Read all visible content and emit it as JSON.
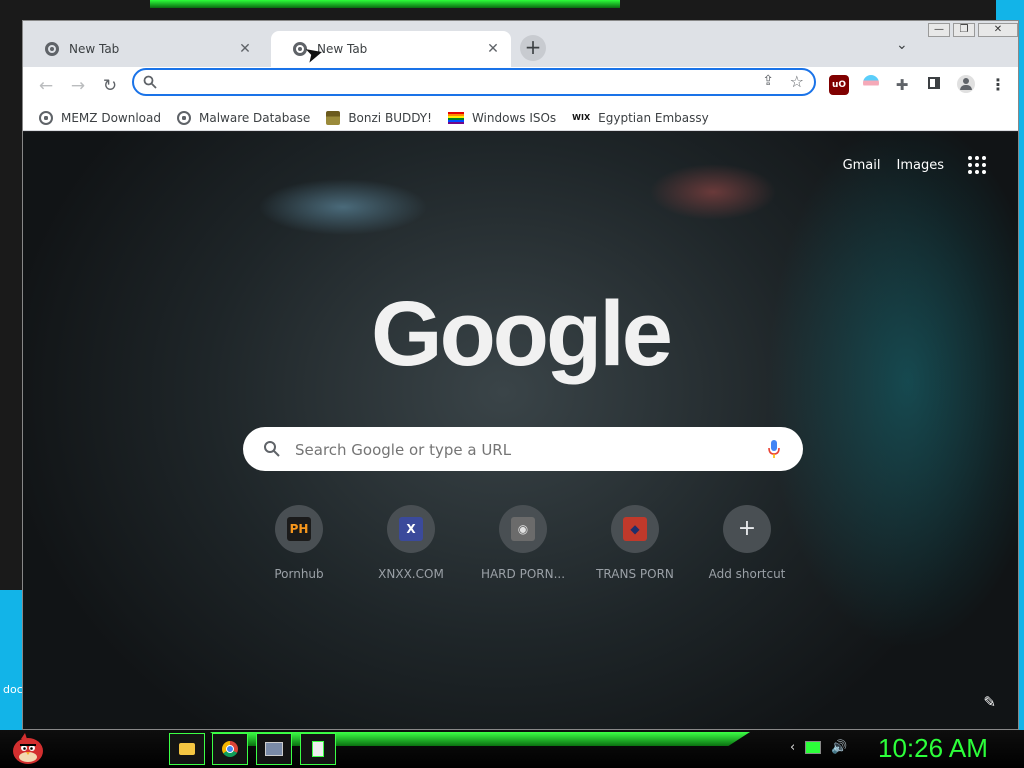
{
  "tabs": [
    {
      "label": "New Tab",
      "active": false
    },
    {
      "label": "New Tab",
      "active": true
    }
  ],
  "address_bar": {
    "value": "",
    "placeholder": ""
  },
  "bookmarks": [
    {
      "label": "MEMZ Download",
      "icon": "globe-icon"
    },
    {
      "label": "Malware Database",
      "icon": "globe-icon"
    },
    {
      "label": "Bonzi BUDDY!",
      "icon": "bonzi-icon"
    },
    {
      "label": "Windows ISOs",
      "icon": "rainbow-flag-icon"
    },
    {
      "label": "Egyptian Embassy",
      "icon": "wix-icon"
    }
  ],
  "page": {
    "top_links": {
      "gmail": "Gmail",
      "images": "Images"
    },
    "logo": "Google",
    "search_placeholder": "Search Google or type a URL",
    "shortcuts": [
      {
        "label": "Pornhub",
        "fav": "PH",
        "fav_bg": "#1b1b1b",
        "fav_color": "#f7971d"
      },
      {
        "label": "XNXX.COM",
        "fav": "X",
        "fav_bg": "#3b4a9b",
        "fav_color": "#ffffff"
      },
      {
        "label": "HARD PORN...",
        "fav": "◉",
        "fav_bg": "#6b6b6b",
        "fav_color": "#e0e0e0"
      },
      {
        "label": "TRANS PORN",
        "fav": "◆",
        "fav_bg": "#c0392b",
        "fav_color": "#1f2f6b"
      },
      {
        "label": "Add shortcut",
        "fav": "+",
        "fav_bg": "transparent",
        "fav_color": "#e8eaed"
      }
    ]
  },
  "taskbar": {
    "clock": "10:26 AM"
  },
  "desktop_label": "doc"
}
